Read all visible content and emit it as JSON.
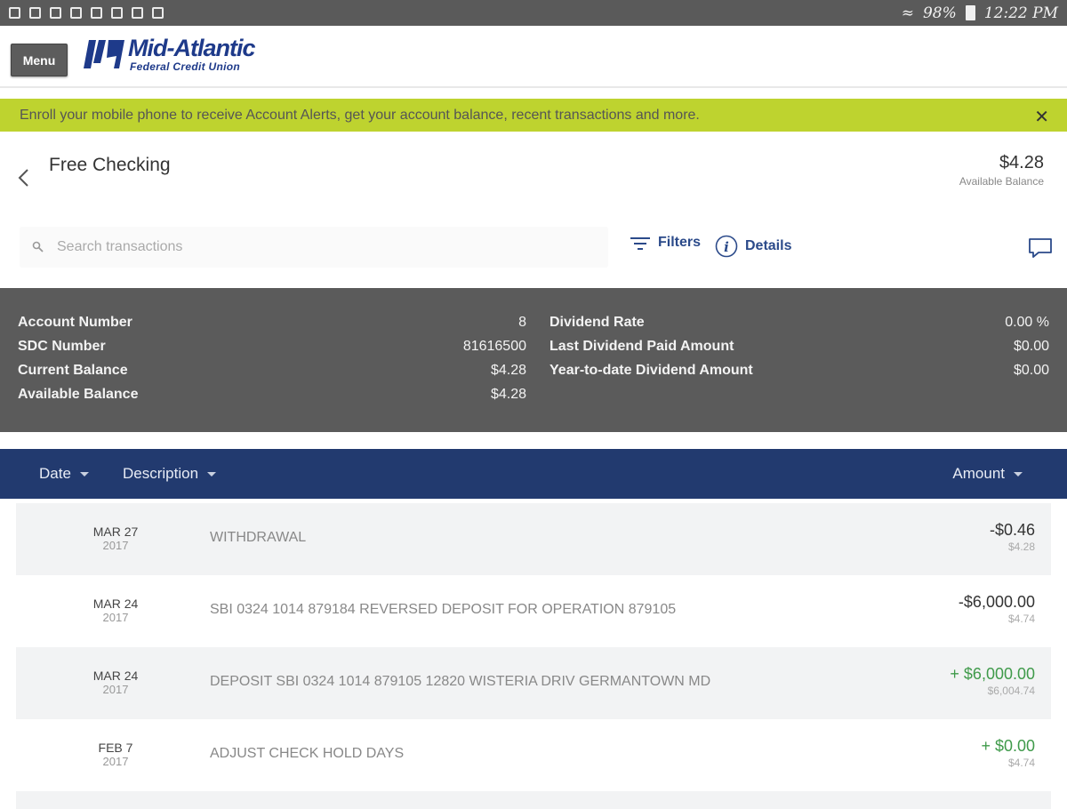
{
  "status_bar": {
    "battery": "98%",
    "time": "12:22 PM"
  },
  "header": {
    "menu_label": "Menu",
    "logo_name": "Mid-Atlantic",
    "logo_sub": "Federal Credit Union"
  },
  "alert": {
    "text": "Enroll your mobile phone to receive Account Alerts, get your account balance, recent transactions and more.",
    "close": "✕"
  },
  "account": {
    "title": "Free Checking",
    "balance": "$4.28",
    "balance_label": "Available Balance"
  },
  "toolbar": {
    "search_placeholder": "Search transactions",
    "filters_label": "Filters",
    "details_label": "Details"
  },
  "summary": {
    "left": [
      {
        "label": "Account Number",
        "value": "8"
      },
      {
        "label": "SDC Number",
        "value": "81616500"
      },
      {
        "label": "Current Balance",
        "value": "$4.28"
      },
      {
        "label": "Available Balance",
        "value": "$4.28"
      }
    ],
    "right": [
      {
        "label": "Dividend Rate",
        "value": "0.00 %"
      },
      {
        "label": "Last Dividend Paid Amount",
        "value": "$0.00"
      },
      {
        "label": "Year-to-date Dividend Amount",
        "value": "$0.00"
      }
    ]
  },
  "table": {
    "columns": [
      "Date",
      "Description",
      "Amount"
    ],
    "rows": [
      {
        "date": "MAR 27",
        "year": "2017",
        "description": "WITHDRAWAL",
        "amount": "-$0.46",
        "balance": "$4.28",
        "positive": false
      },
      {
        "date": "MAR 24",
        "year": "2017",
        "description": "SBI 0324 1014 879184 REVERSED DEPOSIT FOR OPERATION 879105",
        "amount": "-$6,000.00",
        "balance": "$4.74",
        "positive": false
      },
      {
        "date": "MAR 24",
        "year": "2017",
        "description": "DEPOSIT SBI 0324 1014 879105 12820 WISTERIA DRIV GERMANTOWN MD",
        "amount": "+ $6,000.00",
        "balance": "$6,004.74",
        "positive": true
      },
      {
        "date": "FEB 7",
        "year": "2017",
        "description": "ADJUST CHECK HOLD DAYS",
        "amount": "+ $0.00",
        "balance": "$4.74",
        "positive": true
      }
    ]
  },
  "colors": {
    "alert_bg": "#bed32f",
    "table_header_bg": "#223a6f",
    "summary_bg": "#5b5b5b",
    "positive": "#3f9a4a",
    "brand": "#1e3a8a"
  }
}
